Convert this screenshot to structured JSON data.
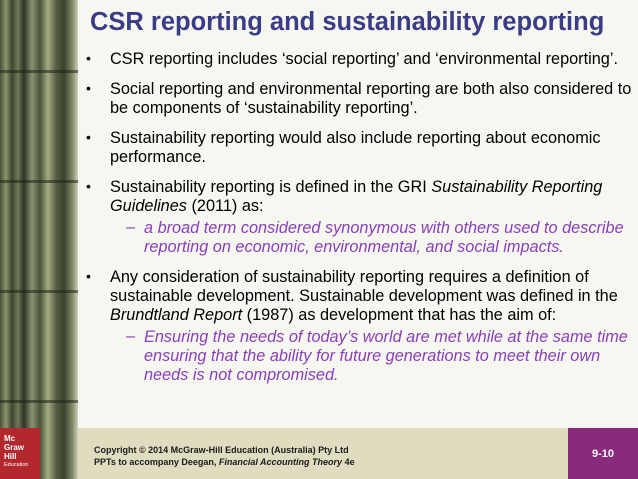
{
  "slide": {
    "title": "CSR reporting and sustainability reporting",
    "slide_number": "9-10"
  },
  "bullets": [
    {
      "text": "CSR reporting includes ‘social reporting’ and ‘environmental reporting’."
    },
    {
      "text": "Social reporting and environmental reporting are both also considered to be components of ‘sustainability reporting’."
    },
    {
      "text": "Sustainability reporting would also include reporting about economic performance."
    },
    {
      "text_before": "Sustainability reporting is defined in the GRI ",
      "text_italic": "Sustainability Reporting Guidelines",
      "text_after": " (2011) as:",
      "sub": "a broad term considered synonymous with others used to describe reporting on economic, environmental, and social impacts."
    },
    {
      "text_before": "Any consideration of sustainability reporting requires a definition of sustainable development. Sustainable development was defined in the ",
      "text_italic": "Brundtland Report",
      "text_after": " (1987) as development that has the aim of:",
      "sub": "Ensuring the needs of today’s world are met while at the same time ensuring that the ability for future generations to meet their own needs is not compromised."
    }
  ],
  "footer": {
    "copyright": "Copyright © 2014 McGraw-Hill Education (Australia) Pty Ltd",
    "ppt_prefix": "PPTs to accompany Deegan, ",
    "ppt_italic": "Financial Accounting Theory",
    "ppt_suffix": " 4e"
  },
  "logo": {
    "line1": "Mc",
    "line2": "Graw",
    "line3": "Hill",
    "line4": "Education"
  },
  "colors": {
    "title": "#3a3c86",
    "sub_bullet": "#8a3fb8",
    "slide_number_bg": "#8a2a7c",
    "footer_bg": "#e0dcbf",
    "logo_bg": "#b3282d"
  },
  "bullet_glyph": "•",
  "sub_glyph": "–"
}
